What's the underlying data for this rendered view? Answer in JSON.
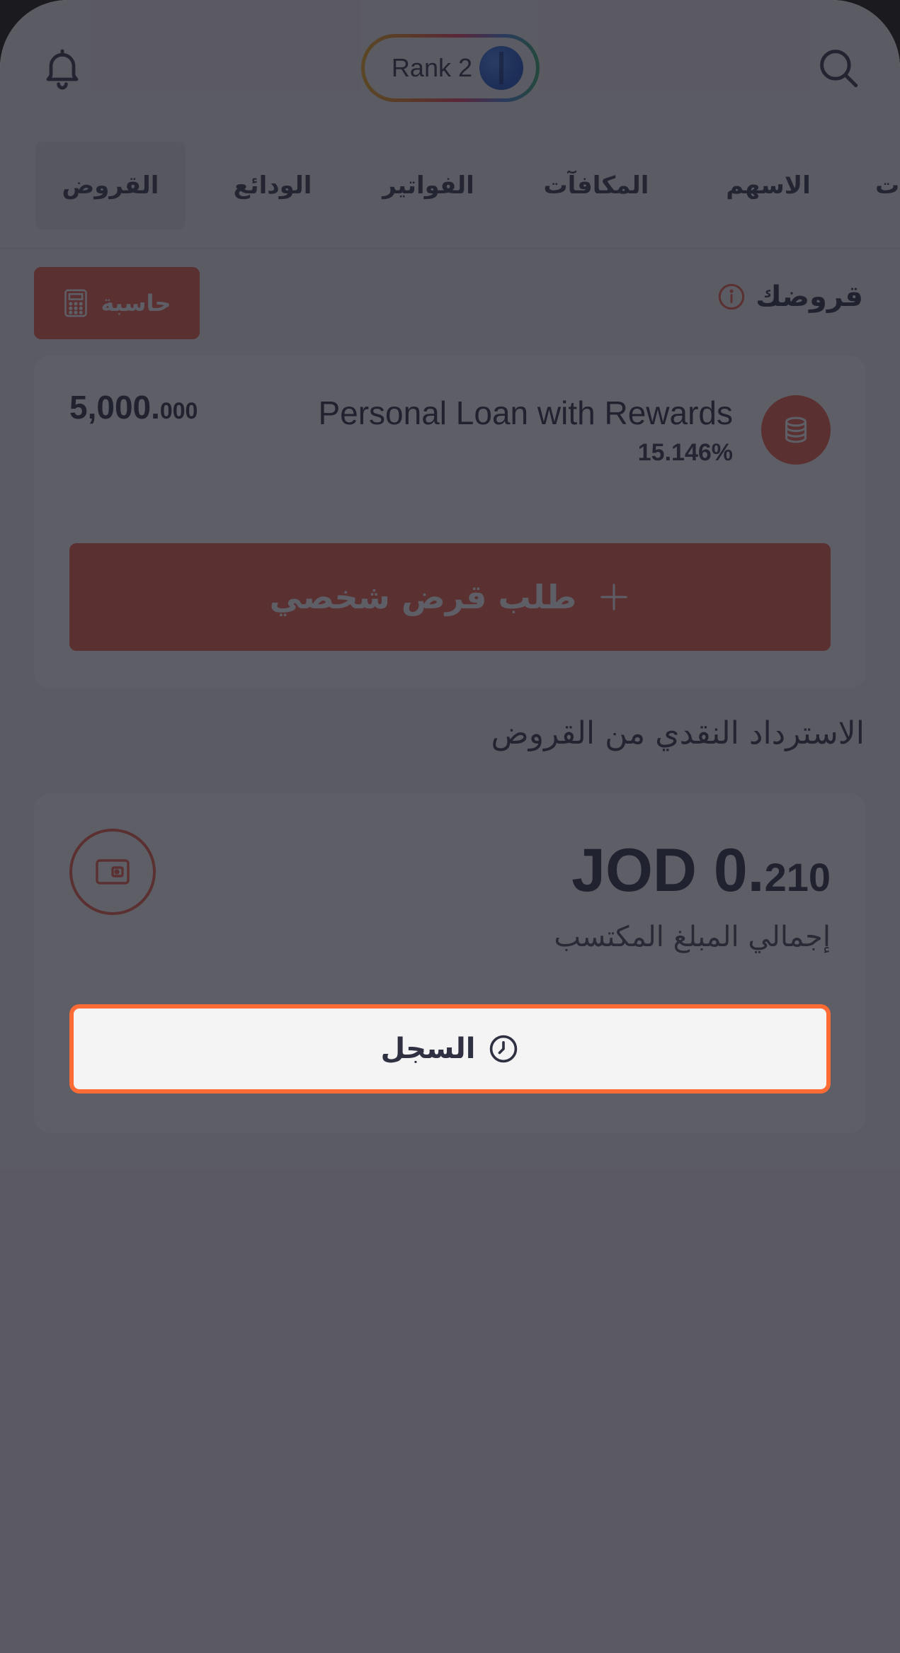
{
  "header": {
    "bell_icon": "bell-icon",
    "search_icon": "search-icon",
    "rank_label": "Rank 2",
    "rank_badge_icon": "rank-badge-icon"
  },
  "tabs": [
    {
      "label": "القروض",
      "active": true
    },
    {
      "label": "الودائع",
      "active": false
    },
    {
      "label": "الفواتير",
      "active": false
    },
    {
      "label": "المكافآت",
      "active": false
    },
    {
      "label": "الاسهم",
      "active": false
    },
    {
      "label": "ت",
      "active": false
    }
  ],
  "loans": {
    "title": "قروضك",
    "calculator_label": "حاسبة",
    "loan_name": "Personal Loan with Rewards",
    "loan_rate": "15.146%",
    "amount_int": "5,000.",
    "amount_dec": "000",
    "request_label": "طلب قرض شخصي"
  },
  "cashback": {
    "title": "الاسترداد النقدي من القروض",
    "amount_int": "JOD 0.",
    "amount_dec": "210",
    "amount_label": "إجمالي المبلغ المكتسب",
    "history_label": "السجل"
  },
  "colors": {
    "accent": "#f3614a",
    "highlight": "#ff6b35",
    "text_dark": "#2f3143",
    "overlay": "#1c1c28"
  }
}
